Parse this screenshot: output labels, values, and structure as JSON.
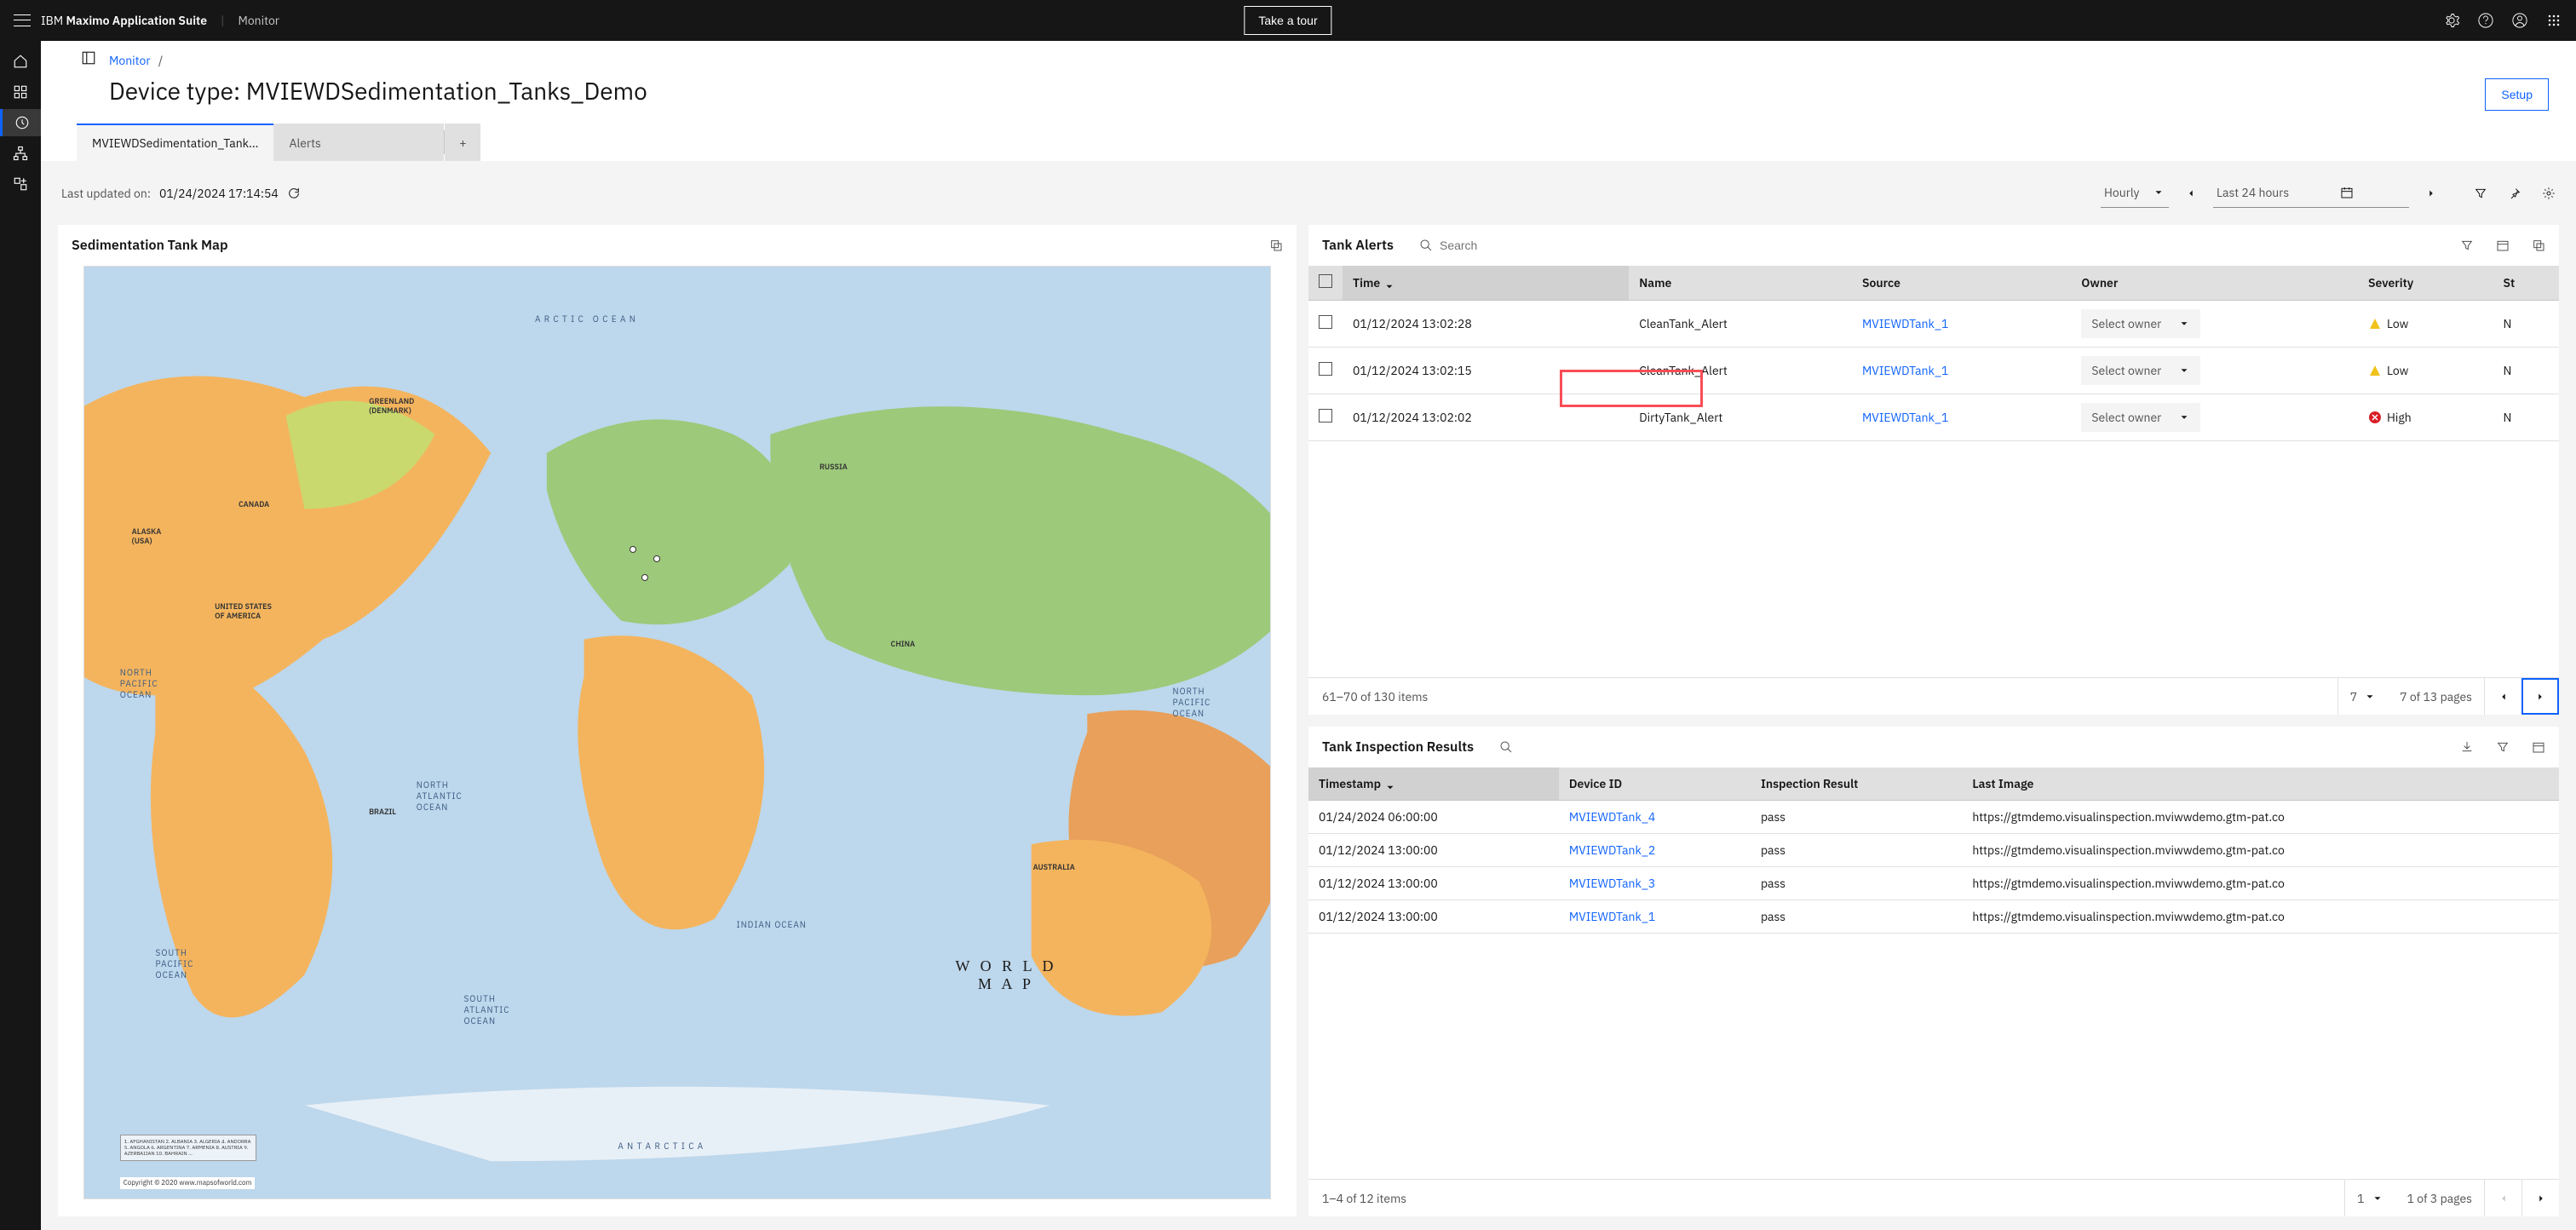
{
  "header": {
    "brand_prefix": "IBM",
    "brand_bold": "Maximo Application Suite",
    "sub": "Monitor",
    "take_tour": "Take a tour"
  },
  "breadcrumb": {
    "root": "Monitor",
    "sep": "/"
  },
  "page_title": "Device type: MVIEWDSedimentation_Tanks_Demo",
  "setup_btn": "Setup",
  "tabs": {
    "t1": "MVIEWDSedimentation_Tank...",
    "t2": "Alerts",
    "add": "+"
  },
  "toolbar": {
    "updated_label": "Last updated on:",
    "updated_ts": "01/24/2024 17:14:54",
    "granularity": "Hourly",
    "range": "Last 24 hours"
  },
  "map_card": {
    "title": "Sedimentation Tank Map",
    "world_map_label": "WORLD\nMAP"
  },
  "alerts_card": {
    "title": "Tank Alerts",
    "search_placeholder": "Search",
    "cols": {
      "time": "Time",
      "name": "Name",
      "source": "Source",
      "owner": "Owner",
      "severity": "Severity",
      "status": "St"
    },
    "owner_placeholder": "Select owner",
    "rows": [
      {
        "time": "01/12/2024 13:02:28",
        "name": "CleanTank_Alert",
        "source": "MVIEWDTank_1",
        "severity": "Low",
        "sev_level": "low"
      },
      {
        "time": "01/12/2024 13:02:15",
        "name": "CleanTank_Alert",
        "source": "MVIEWDTank_1",
        "severity": "Low",
        "sev_level": "low"
      },
      {
        "time": "01/12/2024 13:02:02",
        "name": "DirtyTank_Alert",
        "source": "MVIEWDTank_1",
        "severity": "High",
        "sev_level": "high"
      }
    ],
    "pagination": {
      "range": "61–70 of 130 items",
      "per": "7",
      "pages": "7 of 13 pages"
    }
  },
  "inspection_card": {
    "title": "Tank Inspection Results",
    "cols": {
      "ts": "Timestamp",
      "device": "Device ID",
      "result": "Inspection Result",
      "image": "Last Image"
    },
    "rows": [
      {
        "ts": "01/24/2024 06:00:00",
        "device": "MVIEWDTank_4",
        "result": "pass",
        "image": "https://gtmdemo.visualinspection.mviwwdemo.gtm-pat.co"
      },
      {
        "ts": "01/12/2024 13:00:00",
        "device": "MVIEWDTank_2",
        "result": "pass",
        "image": "https://gtmdemo.visualinspection.mviwwdemo.gtm-pat.co"
      },
      {
        "ts": "01/12/2024 13:00:00",
        "device": "MVIEWDTank_3",
        "result": "pass",
        "image": "https://gtmdemo.visualinspection.mviwwdemo.gtm-pat.co"
      },
      {
        "ts": "01/12/2024 13:00:00",
        "device": "MVIEWDTank_1",
        "result": "pass",
        "image": "https://gtmdemo.visualinspection.mviwwdemo.gtm-pat.co"
      }
    ],
    "pagination": {
      "range": "1–4 of 12 items",
      "per": "1",
      "pages": "1 of 3 pages"
    }
  }
}
